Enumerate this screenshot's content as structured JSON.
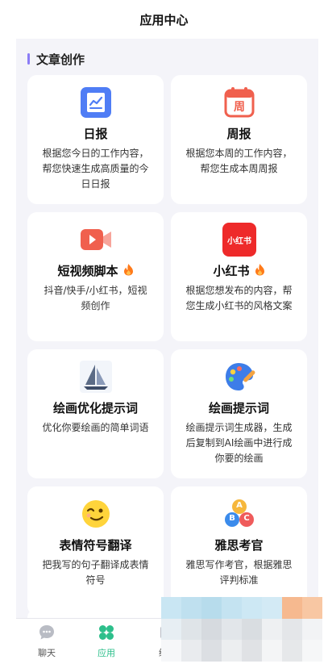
{
  "header": {
    "title": "应用中心"
  },
  "section": {
    "title": "文章创作"
  },
  "cards": [
    {
      "name": "日报",
      "desc": "根据您今日的工作内容，帮您快速生成高质量的今日日报",
      "icon": "daily-report-icon",
      "hot": false
    },
    {
      "name": "周报",
      "desc": "根据您本周的工作内容，帮您生成本周周报",
      "icon": "weekly-report-icon",
      "icon_text": "周",
      "hot": false
    },
    {
      "name": "短视频脚本",
      "desc": "抖音/快手/小红书，短视频创作",
      "icon": "video-camera-icon",
      "hot": true
    },
    {
      "name": "小红书",
      "desc": "根据您想发布的内容，帮您生成小红书的风格文案",
      "icon": "xiaohongshu-logo-icon",
      "icon_text": "小红书",
      "hot": true
    },
    {
      "name": "绘画优化提示词",
      "desc": "优化你要绘画的简单词语",
      "icon": "sailboat-icon",
      "hot": false
    },
    {
      "name": "绘画提示词",
      "desc": "绘画提示词生成器，生成后复制到AI绘画中进行成你要的绘画",
      "icon": "paint-palette-icon",
      "hot": false
    },
    {
      "name": "表情符号翻译",
      "desc": "把我写的句子翻译成表情符号",
      "icon": "emoji-face-icon",
      "hot": false
    },
    {
      "name": "雅思考官",
      "desc": "雅思写作考官，根据雅思评判标准",
      "icon": "abc-blocks-icon",
      "icon_letters": [
        "A",
        "B",
        "C"
      ],
      "hot": false
    }
  ],
  "tabs": [
    {
      "label": "聊天",
      "icon": "chat-bubble-icon",
      "active": false
    },
    {
      "label": "应用",
      "icon": "apps-clover-icon",
      "active": true
    },
    {
      "label": "绘画",
      "icon": "image-icon",
      "active": false
    }
  ],
  "colors": {
    "accent": "#2dbf8b",
    "section_bar": "#8b7cf6",
    "hot": "#ff7a1a"
  }
}
